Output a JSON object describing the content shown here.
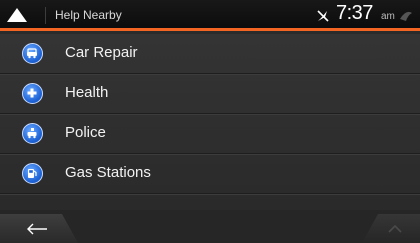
{
  "header": {
    "title": "Help Nearby",
    "time": "7:37",
    "ampm": "am",
    "accent_color": "#f26522"
  },
  "items": [
    {
      "label": "Car Repair",
      "icon": "car-repair-icon"
    },
    {
      "label": "Health",
      "icon": "health-cross-icon"
    },
    {
      "label": "Police",
      "icon": "police-icon"
    },
    {
      "label": "Gas Stations",
      "icon": "gas-station-icon"
    }
  ],
  "footer": {
    "back_icon": "arrow-left-icon",
    "up_icon": "chevron-up-icon"
  }
}
